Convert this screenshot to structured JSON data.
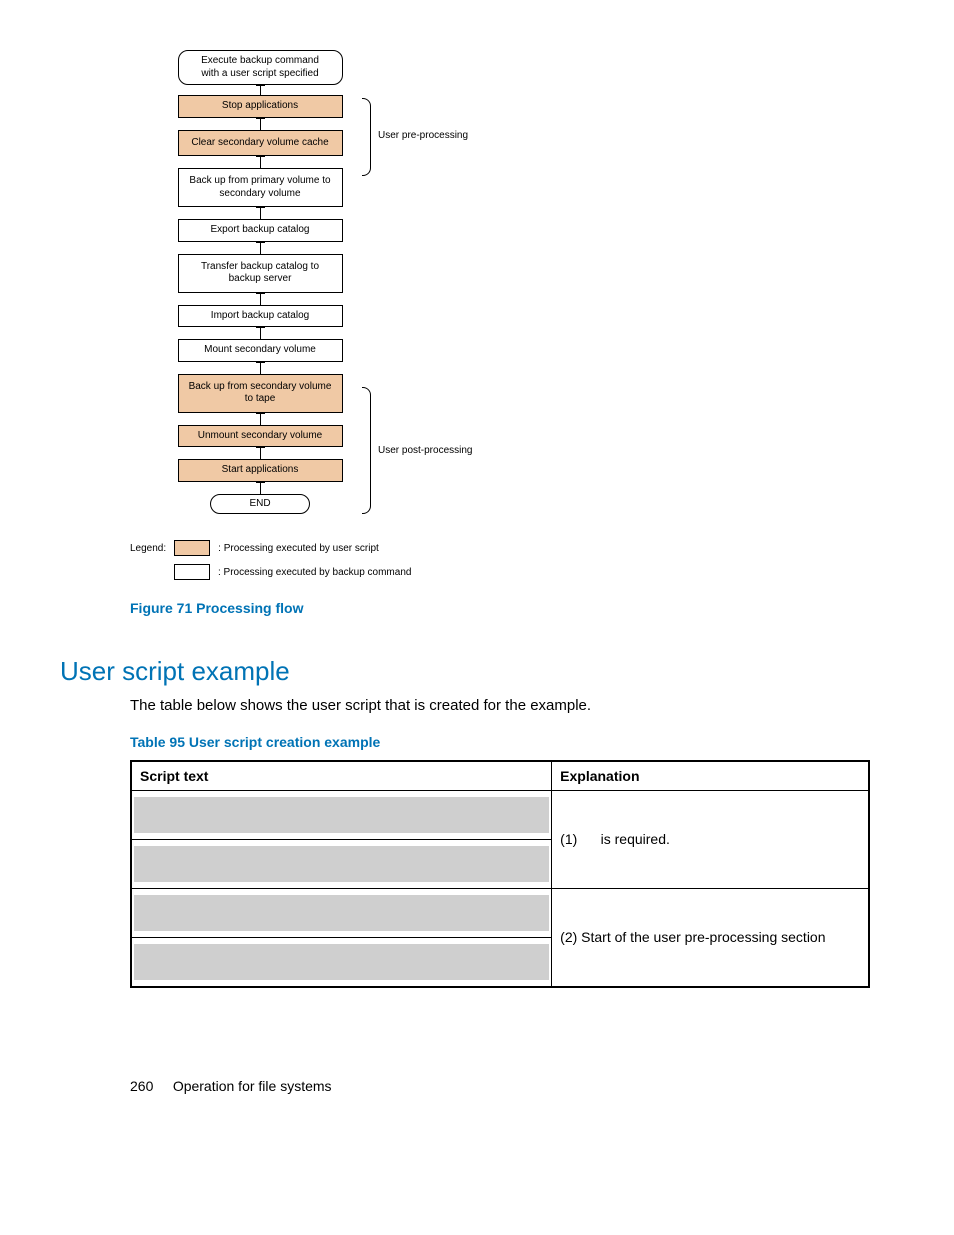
{
  "flow": {
    "start": "Execute backup command\nwith a user script specified",
    "steps": [
      {
        "text": "Stop applications",
        "tan": true
      },
      {
        "text": "Clear secondary volume cache",
        "tan": true
      },
      {
        "text": "Back up from primary volume to\nsecondary volume",
        "tan": false
      },
      {
        "text": "Export backup catalog",
        "tan": false
      },
      {
        "text": "Transfer backup catalog to\nbackup server",
        "tan": false
      },
      {
        "text": "Import backup catalog",
        "tan": false
      },
      {
        "text": "Mount secondary volume",
        "tan": false
      },
      {
        "text": "Back up from secondary volume\nto tape",
        "tan": true
      },
      {
        "text": "Unmount secondary volume",
        "tan": true
      },
      {
        "text": "Start applications",
        "tan": true
      }
    ],
    "end": "END",
    "pre_label": "User pre-processing",
    "post_label": "User post-processing"
  },
  "legend": {
    "title": "Legend:",
    "tan": ": Processing executed by user script",
    "white": ": Processing executed by backup command"
  },
  "figure_caption": "Figure 71 Processing flow",
  "section_title": "User script example",
  "intro_text": "The table below shows the user script that is created for the example.",
  "table_caption": "Table 95 User script creation example",
  "table": {
    "header_left": "Script text",
    "header_right": "Explanation",
    "row1_num": "(1)",
    "row1_text": "is required.",
    "row2_text": "(2) Start of the user pre-processing section"
  },
  "footer": {
    "page": "260",
    "label": "Operation for file systems"
  }
}
